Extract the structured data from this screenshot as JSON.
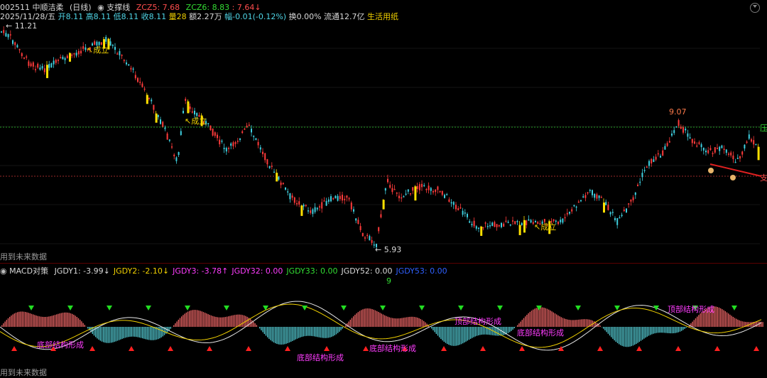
{
  "header": {
    "code": "002511",
    "name": "中顺洁柔",
    "period": "(日线)",
    "indicator": "支撑线",
    "zcz5_label": "ZCZ5:",
    "zcz5_val": "7.68",
    "zcz6_label": "ZCZ6:",
    "zcz6_val": "8.83",
    "sep": ":",
    "third_val": "7.64",
    "arrow": "↓"
  },
  "quote": {
    "date": "2025/11/28/五",
    "open": "开8.11",
    "high": "高8.11",
    "low": "低8.11",
    "close": "收8.11",
    "volume": "量28",
    "amount": "额2.27万",
    "change": "幅-0.01(-0.12%)",
    "turnover": "换0.00%",
    "float": "流通12.7亿",
    "sector": "生活用纸"
  },
  "main_chart": {
    "high_label": "11.21",
    "low_label": "5.93",
    "peak_label": "9.07",
    "signal_text": "成立",
    "future_note": "用到未来数据",
    "right_labels": [
      "压",
      "支"
    ],
    "colors": {
      "up": "#ff3b3b",
      "down": "#3fd0e0",
      "signal": "#ffe000",
      "resist": "#22aa22",
      "support": "#bb3333"
    }
  },
  "indicator": {
    "title": "MACD对策",
    "items": [
      {
        "label": "JGDY1: -3.99",
        "arrow": "↓",
        "color": "#d9d9d9"
      },
      {
        "label": "JGDY2: -2.10",
        "arrow": "↓",
        "color": "#f0d000"
      },
      {
        "label": "JGDY3: -3.78",
        "arrow": "↑",
        "color": "#ff3dff"
      },
      {
        "label": "JGDY32: 0.00",
        "arrow": "",
        "color": "#ff3dff"
      },
      {
        "label": "JGDY33: 0.00",
        "arrow": "",
        "color": "#33dd33"
      },
      {
        "label": "JGDY52: 0.00",
        "arrow": "",
        "color": "#d9d9d9"
      },
      {
        "label": "JGDY53: 0.00",
        "arrow": "",
        "color": "#2f60ff"
      }
    ],
    "texts": [
      "底部结构形成",
      "顶部结构形成"
    ],
    "nine": "9",
    "future_note": "用到未来数据"
  }
}
